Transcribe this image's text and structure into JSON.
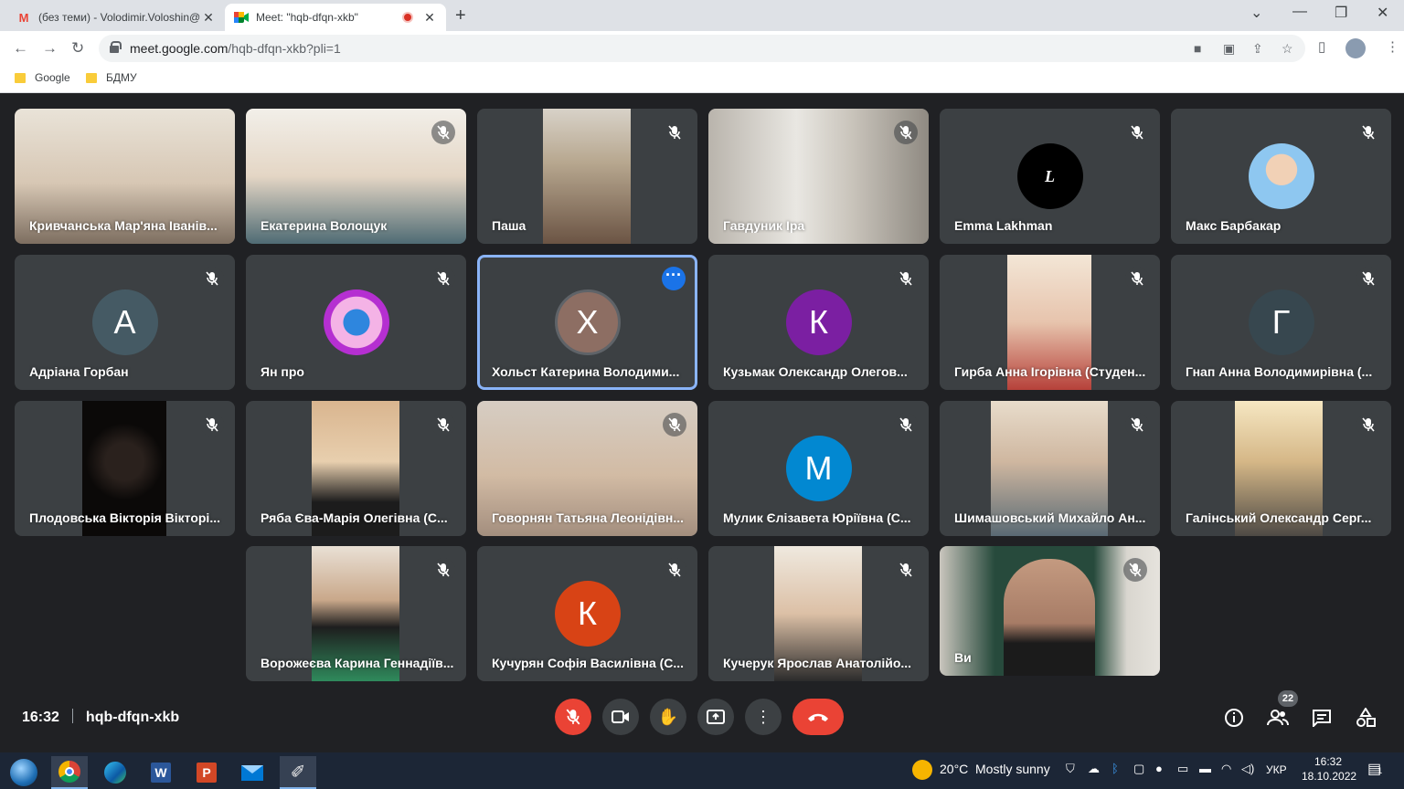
{
  "browser": {
    "tabs": [
      {
        "title": "(без теми) - Volodimir.Voloshin@",
        "favicon": "gmail-icon",
        "active": false
      },
      {
        "title": "Meet: \"hqb-dfqn-xkb\"",
        "favicon": "meet-icon",
        "active": true
      }
    ],
    "url_host": "meet.google.com",
    "url_path": "/hqb-dfqn-xkb?pli=1",
    "bookmarks": [
      "Google",
      "БДМУ"
    ]
  },
  "meet": {
    "time": "16:32",
    "code": "hqb-dfqn-xkb",
    "participant_count": "22",
    "participants": [
      {
        "name": "Кривчанська Мар'яна Іванів...",
        "kind": "video"
      },
      {
        "name": "Екатерина Волощук",
        "kind": "video"
      },
      {
        "name": "Паша",
        "kind": "video"
      },
      {
        "name": "Гавдуник Іра",
        "kind": "video"
      },
      {
        "name": "Emma Lakhman",
        "kind": "avatar",
        "initial": "L"
      },
      {
        "name": "Макс Барбакар",
        "kind": "photo-avatar"
      },
      {
        "name": "Адріана Горбан",
        "kind": "avatar",
        "initial": "А"
      },
      {
        "name": "Ян про",
        "kind": "photo-avatar"
      },
      {
        "name": "Хольст Катерина Володими...",
        "kind": "avatar",
        "initial": "Х"
      },
      {
        "name": "Кузьмак Олександр Олегов...",
        "kind": "avatar",
        "initial": "К"
      },
      {
        "name": "Гирба Анна Ігорівна (Студен...",
        "kind": "video"
      },
      {
        "name": "Гнап Анна Володимирівна (...",
        "kind": "avatar",
        "initial": "Г"
      },
      {
        "name": "Плодовська Вікторія Вікторі...",
        "kind": "video"
      },
      {
        "name": "Ряба Єва-Марія Олегівна (С...",
        "kind": "video"
      },
      {
        "name": "Говорнян Татьяна Леонідівн...",
        "kind": "video"
      },
      {
        "name": "Мулик Єлізавета Юріївна (С...",
        "kind": "avatar",
        "initial": "М"
      },
      {
        "name": "Шимашовський Михайло Ан...",
        "kind": "video"
      },
      {
        "name": "Галінський Олександр Серг...",
        "kind": "video"
      },
      {
        "name": "Ворожеєва Карина Геннадіїв...",
        "kind": "video"
      },
      {
        "name": "Кучурян Софія Василівна (С...",
        "kind": "avatar",
        "initial": "К"
      },
      {
        "name": "Кучерук Ярослав Анатолійо...",
        "kind": "video"
      },
      {
        "name": "Ви",
        "kind": "video"
      }
    ],
    "colors": {
      "accent": "#1a73e8",
      "danger": "#ea4335",
      "tile": "#3c4043"
    }
  },
  "taskbar": {
    "weather_temp": "20°C",
    "weather_text": "Mostly sunny",
    "language": "УКР",
    "clock_time": "16:32",
    "clock_date": "18.10.2022",
    "notification_count": "1"
  }
}
